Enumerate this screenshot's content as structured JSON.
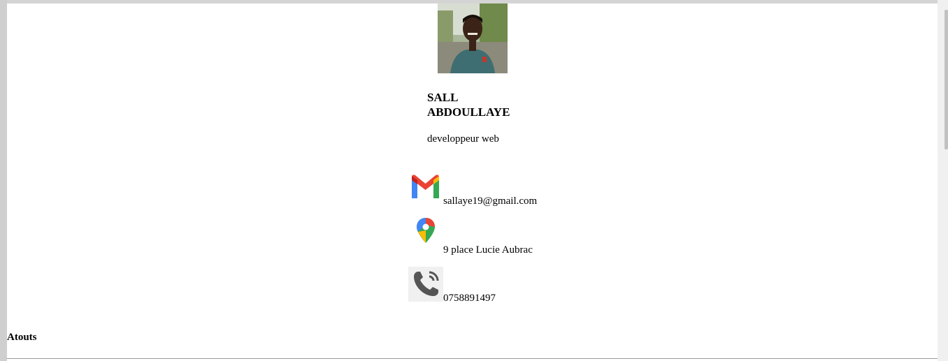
{
  "profile": {
    "last_name": "SALL",
    "first_name": "ABDOULLAYE",
    "role": "developpeur web",
    "photo_icon": "profile-photo"
  },
  "contacts": [
    {
      "icon": "gmail-icon",
      "text": "sallaye19@gmail.com"
    },
    {
      "icon": "google-maps-icon",
      "text": "9 place Lucie Aubrac",
      "icon_caption": "Google Maps"
    },
    {
      "icon": "phone-icon",
      "text": "0758891497"
    }
  ],
  "sections": {
    "atouts_heading": "Atouts"
  },
  "colors": {
    "page_bg": "#ffffff",
    "frame_bg": "#d9d9d9",
    "gmail_red": "#ea4335",
    "gmail_blue": "#4285f4",
    "gmail_green": "#34a853",
    "gmail_yellow": "#fbbc04",
    "phone_gray": "#555555"
  }
}
